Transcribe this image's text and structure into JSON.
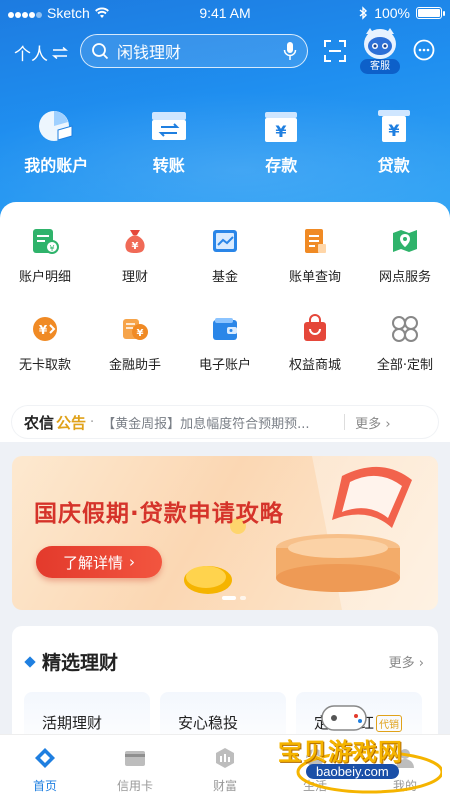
{
  "status_bar": {
    "carrier": "Sketch",
    "time": "9:41 AM",
    "battery": "100%"
  },
  "top_bar": {
    "persona": "个人",
    "search_placeholder": "闲钱理财",
    "service_label": "客服"
  },
  "quick_actions": [
    {
      "label": "我的账户",
      "icon": "account-pie-icon"
    },
    {
      "label": "转账",
      "icon": "transfer-icon"
    },
    {
      "label": "存款",
      "icon": "deposit-icon"
    },
    {
      "label": "贷款",
      "icon": "loan-icon"
    }
  ],
  "services": [
    {
      "label": "账户明细",
      "icon": "account-detail-icon",
      "color": "#2fb36b"
    },
    {
      "label": "理财",
      "icon": "money-bag-icon",
      "color": "#e5473a"
    },
    {
      "label": "基金",
      "icon": "fund-chart-icon",
      "color": "#2a86e8"
    },
    {
      "label": "账单查询",
      "icon": "bill-icon",
      "color": "#f08a24"
    },
    {
      "label": "网点服务",
      "icon": "map-pin-icon",
      "color": "#2fb36b"
    },
    {
      "label": "无卡取款",
      "icon": "cardless-withdraw-icon",
      "color": "#f08a24"
    },
    {
      "label": "金融助手",
      "icon": "coins-icon",
      "color": "#f08a24"
    },
    {
      "label": "电子账户",
      "icon": "wallet-icon",
      "color": "#2a86e8"
    },
    {
      "label": "权益商城",
      "icon": "mall-bag-icon",
      "color": "#e5473a"
    },
    {
      "label": "全部·定制",
      "icon": "all-grid-icon",
      "color": "#888888"
    }
  ],
  "notice": {
    "brand": "农信",
    "tag": "公告",
    "text": "【黄金周报】加息幅度符合预期预...",
    "more": "更多"
  },
  "banner": {
    "title": "国庆假期·贷款申请攻略",
    "button": "了解详情"
  },
  "picks": {
    "title": "精选理财",
    "more": "更多",
    "items": [
      {
        "label": "活期理财"
      },
      {
        "label": "安心稳投"
      },
      {
        "label": "定期分红",
        "badge": "代销"
      }
    ]
  },
  "tabs": [
    {
      "label": "首页",
      "icon": "home-icon",
      "active": true
    },
    {
      "label": "信用卡",
      "icon": "credit-card-icon",
      "active": false
    },
    {
      "label": "财富",
      "icon": "wealth-icon",
      "active": false
    },
    {
      "label": "生活",
      "icon": "life-icon",
      "active": false
    },
    {
      "label": "我的",
      "icon": "profile-icon",
      "active": false
    }
  ],
  "watermark": {
    "text": "宝贝游戏网",
    "url": "baobeiy.com"
  },
  "colors": {
    "primary": "#1f7fe0",
    "accent_red": "#e33a2c",
    "accent_gold": "#e0a21a"
  }
}
